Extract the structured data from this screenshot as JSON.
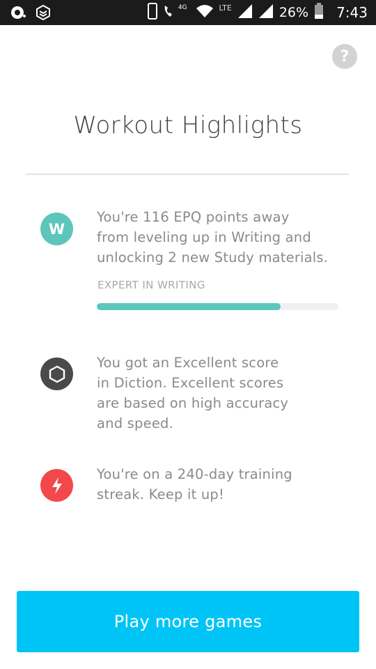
{
  "status_bar": {
    "network_4g": "4G",
    "network_lte": "LTE",
    "battery": "26%",
    "time": "7:43"
  },
  "help": {
    "label": "?"
  },
  "title": "Workout Highlights",
  "highlights": [
    {
      "icon": "writing-w-icon",
      "icon_letter": "W",
      "icon_color": "#5cc6bc",
      "lines": [
        "You're 116 EPQ points away",
        "from leveling up in Writing and",
        "unlocking 2 new Study materials."
      ],
      "progress_label": "EXPERT IN WRITING",
      "progress": 0.76
    },
    {
      "icon": "hexagon-icon",
      "icon_color": "#4a4a4a",
      "lines": [
        "You got an Excellent score",
        "in Diction. Excellent scores",
        "are based on high accuracy",
        "and speed."
      ]
    },
    {
      "icon": "lightning-bolt-icon",
      "icon_color": "#f2484b",
      "lines": [
        "You're on a 240-day training",
        "streak. Keep it up!"
      ]
    }
  ],
  "cta": {
    "label": "Play more games",
    "color": "#00c4f6"
  }
}
